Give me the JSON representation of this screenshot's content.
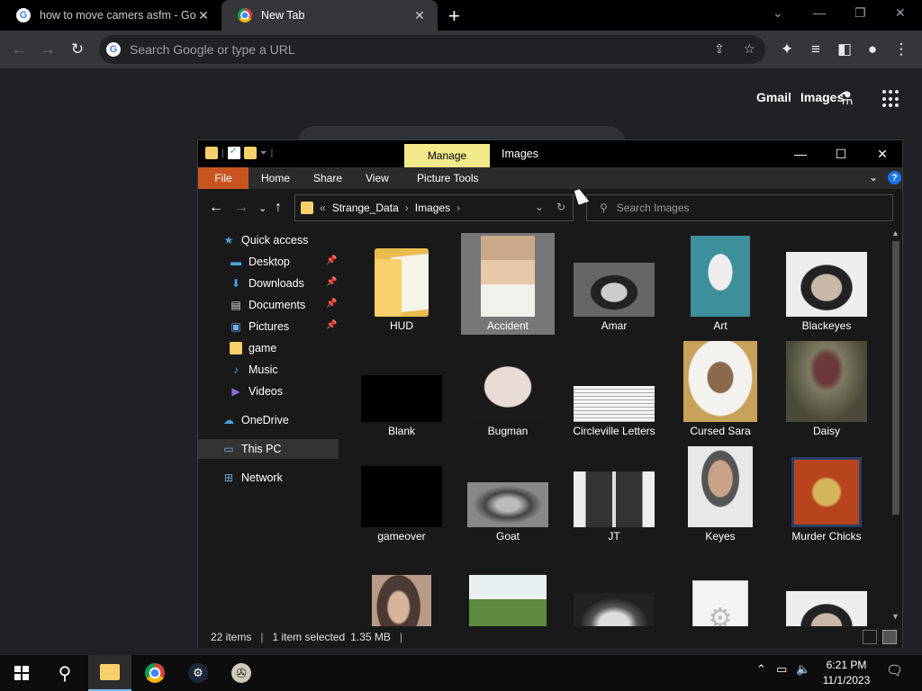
{
  "browser": {
    "tabs": [
      {
        "title": "how to move camers asfm - Goo",
        "active": false
      },
      {
        "title": "New Tab",
        "active": true
      }
    ],
    "omnibox_placeholder": "Search Google or type a URL",
    "ntp": {
      "gmail": "Gmail",
      "images": "Images"
    }
  },
  "explorer": {
    "title": "Images",
    "context_tab": "Manage",
    "ribbon_tabs": [
      "File",
      "Home",
      "Share",
      "View",
      "Picture Tools"
    ],
    "breadcrumb": [
      "Strange_Data",
      "Images"
    ],
    "search_placeholder": "Search Images",
    "nav": {
      "quick_access": "Quick access",
      "items": [
        "Desktop",
        "Downloads",
        "Documents",
        "Pictures",
        "game",
        "Music",
        "Videos"
      ],
      "onedrive": "OneDrive",
      "this_pc": "This PC",
      "network": "Network"
    },
    "files": [
      "HUD",
      "Accident",
      "Amar",
      "Art",
      "Blackeyes",
      "Blank",
      "Bugman",
      "Circleville Letters",
      "Cursed Sara",
      "Daisy",
      "gameover",
      "Goat",
      "JT",
      "Keyes",
      "Murder Chicks",
      "",
      "",
      "",
      "",
      ""
    ],
    "selected_file": "Accident",
    "status": {
      "count": "22 items",
      "selection": "1 item selected",
      "size": "1.35 MB"
    }
  },
  "taskbar": {
    "time": "6:21 PM",
    "date": "11/1/2023"
  },
  "colors": {
    "file_tab": "#c8541f",
    "manage_tab": "#f3ea8c",
    "accent": "#1a73e8"
  }
}
